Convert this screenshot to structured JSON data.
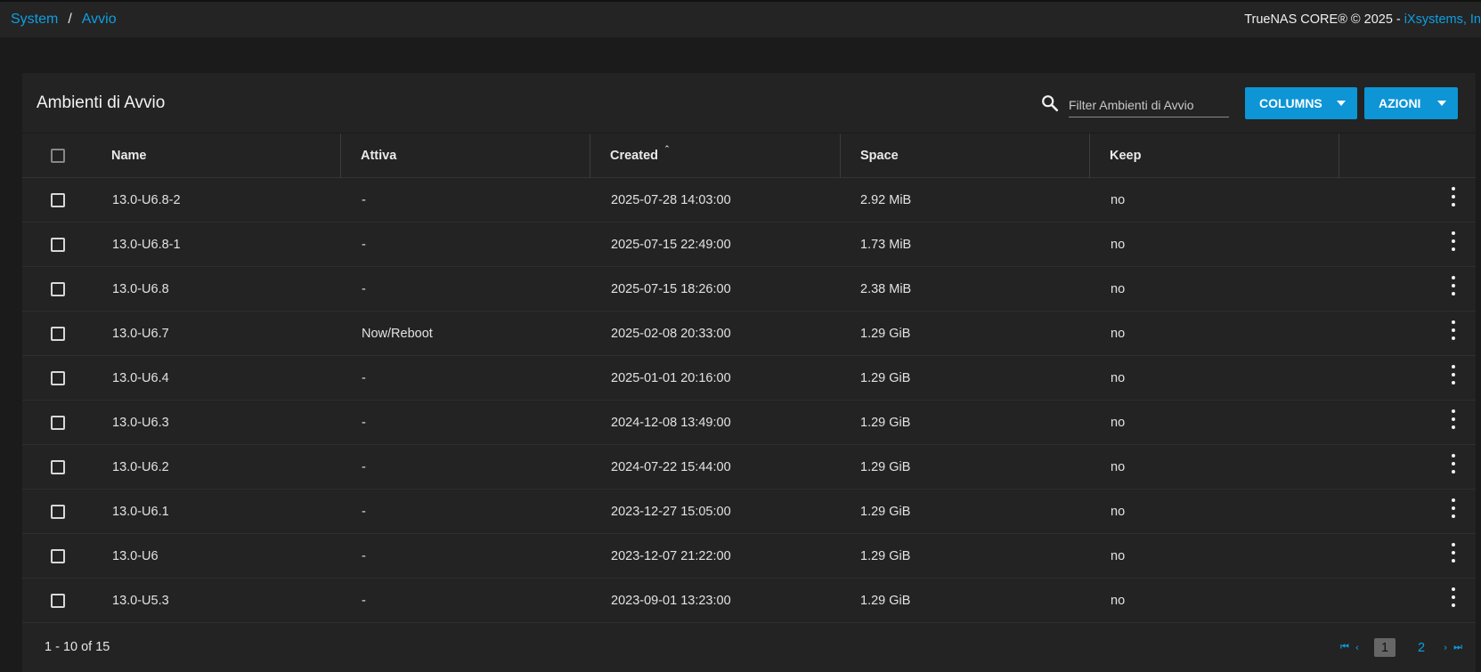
{
  "breadcrumb": {
    "items": [
      "System",
      "Avvio"
    ],
    "separator": "/"
  },
  "copyright": {
    "text": "TrueNAS CORE® © 2025 - ",
    "link": "iXsystems, In"
  },
  "card": {
    "title": "Ambienti di Avvio",
    "filter_placeholder": "Filter Ambienti di Avvio",
    "columns_label": "COLUMNS",
    "azioni_label": "AZIONI"
  },
  "table": {
    "headers": {
      "name": "Name",
      "attiva": "Attiva",
      "created": "Created",
      "space": "Space",
      "keep": "Keep"
    },
    "rows": [
      {
        "name": "13.0-U6.8-2",
        "attiva": "-",
        "created": "2025-07-28 14:03:00",
        "space": "2.92 MiB",
        "keep": "no"
      },
      {
        "name": "13.0-U6.8-1",
        "attiva": "-",
        "created": "2025-07-15 22:49:00",
        "space": "1.73 MiB",
        "keep": "no"
      },
      {
        "name": "13.0-U6.8",
        "attiva": "-",
        "created": "2025-07-15 18:26:00",
        "space": "2.38 MiB",
        "keep": "no"
      },
      {
        "name": "13.0-U6.7",
        "attiva": "Now/Reboot",
        "created": "2025-02-08 20:33:00",
        "space": "1.29 GiB",
        "keep": "no"
      },
      {
        "name": "13.0-U6.4",
        "attiva": "-",
        "created": "2025-01-01 20:16:00",
        "space": "1.29 GiB",
        "keep": "no"
      },
      {
        "name": "13.0-U6.3",
        "attiva": "-",
        "created": "2024-12-08 13:49:00",
        "space": "1.29 GiB",
        "keep": "no"
      },
      {
        "name": "13.0-U6.2",
        "attiva": "-",
        "created": "2024-07-22 15:44:00",
        "space": "1.29 GiB",
        "keep": "no"
      },
      {
        "name": "13.0-U6.1",
        "attiva": "-",
        "created": "2023-12-27 15:05:00",
        "space": "1.29 GiB",
        "keep": "no"
      },
      {
        "name": "13.0-U6",
        "attiva": "-",
        "created": "2023-12-07 21:22:00",
        "space": "1.29 GiB",
        "keep": "no"
      },
      {
        "name": "13.0-U5.3",
        "attiva": "-",
        "created": "2023-09-01 13:23:00",
        "space": "1.29 GiB",
        "keep": "no"
      }
    ]
  },
  "pagination": {
    "range": "1 - 10 of 15",
    "current": "1",
    "next": "2"
  },
  "icons": {
    "search": "search-icon",
    "sort": "sort-desc-icon",
    "more": "more-vert-icon"
  },
  "colors": {
    "accent": "#0e9fe0",
    "button": "#0d95d6",
    "background": "#1b1b1b",
    "card": "#232323"
  }
}
